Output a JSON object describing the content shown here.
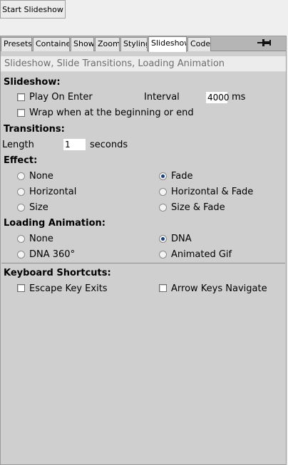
{
  "top": {
    "start_button": "Start Slideshow"
  },
  "tabs": [
    "Presets",
    "Container",
    "Show",
    "Zoom",
    "Styling",
    "Slideshow",
    "Code"
  ],
  "active_tab": "Slideshow",
  "subheader": "Slideshow, Slide Transitions, Loading Animation",
  "slideshow": {
    "heading": "Slideshow:",
    "play_on_enter": {
      "label": "Play On Enter",
      "checked": false
    },
    "interval_label": "Interval",
    "interval_value": "4000",
    "interval_unit": "ms",
    "wrap": {
      "label": "Wrap when at the beginning or end",
      "checked": false
    }
  },
  "transitions": {
    "heading": "Transitions:",
    "length_label": "Length",
    "length_value": "1",
    "length_unit": "seconds"
  },
  "effect": {
    "heading": "Effect:",
    "options": [
      "None",
      "Fade",
      "Horizontal",
      "Horizontal & Fade",
      "Size",
      "Size & Fade"
    ],
    "selected": "Fade"
  },
  "loading": {
    "heading": "Loading Animation:",
    "options": [
      "None",
      "DNA",
      "DNA 360°",
      "Animated Gif"
    ],
    "selected": "DNA"
  },
  "keyboard": {
    "heading": "Keyboard Shortcuts:",
    "escape": {
      "label": "Escape Key Exits",
      "checked": false
    },
    "arrows": {
      "label": "Arrow Keys Navigate",
      "checked": false
    }
  },
  "icons": {
    "pin": "pin-icon"
  }
}
